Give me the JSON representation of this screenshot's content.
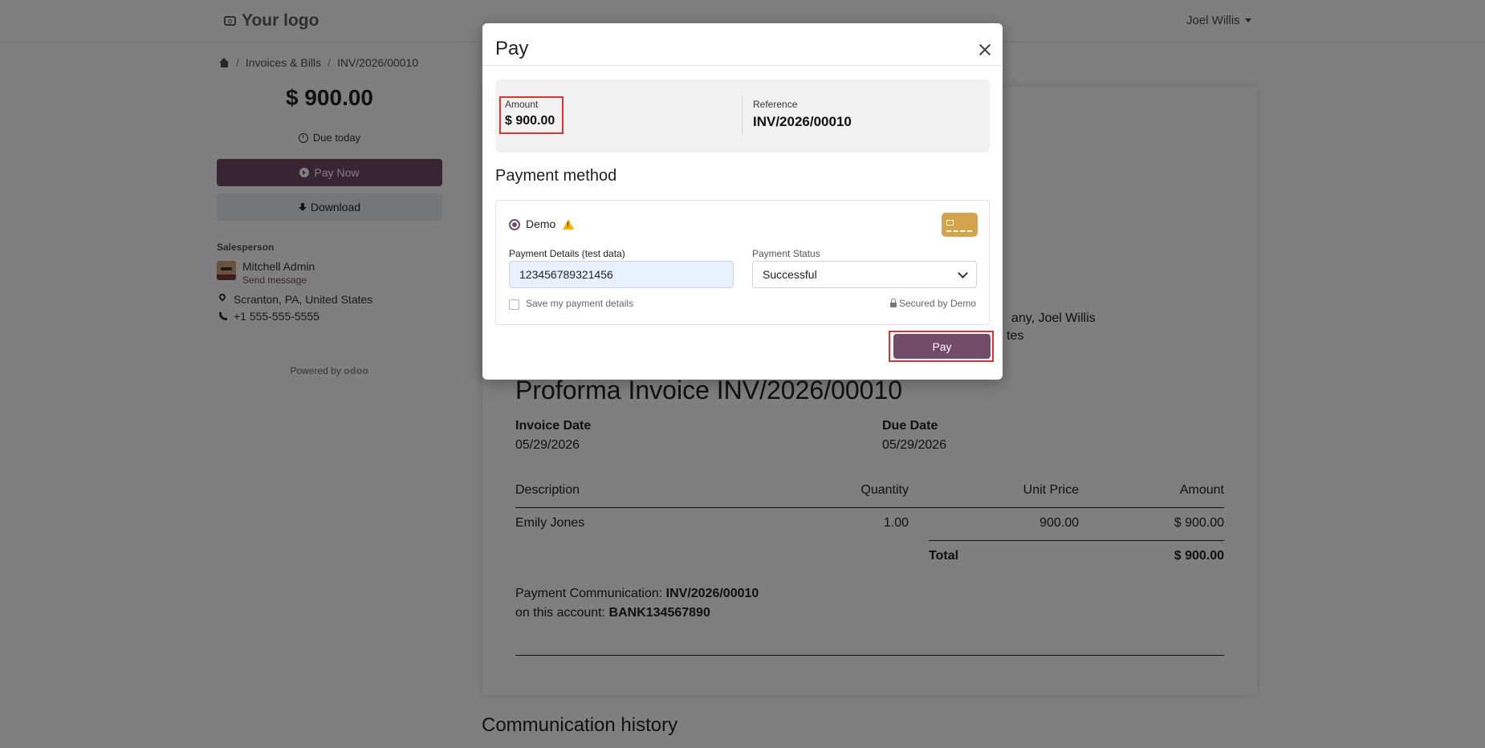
{
  "header": {
    "logo_text": "Your logo",
    "user_name": "Joel Willis"
  },
  "breadcrumb": {
    "section": "Invoices & Bills",
    "current": "INV/2026/00010"
  },
  "sidebar": {
    "amount": "$ 900.00",
    "due": "Due today",
    "pay_now": "Pay Now",
    "download": "Download",
    "salesperson_label": "Salesperson",
    "salesperson_name": "Mitchell Admin",
    "send_message": "Send message",
    "address": "Scranton, PA, United States",
    "phone": "+1 555-555-5555",
    "powered_by": "Powered by",
    "powered_brand": "odoo"
  },
  "document": {
    "partner_line1": "any, Joel Willis",
    "partner_line2": "tes",
    "title": "Proforma Invoice INV/2026/00010",
    "invoice_date_label": "Invoice Date",
    "invoice_date": "05/29/2026",
    "due_date_label": "Due Date",
    "due_date": "05/29/2026",
    "columns": [
      "Description",
      "Quantity",
      "Unit Price",
      "Amount"
    ],
    "rows": [
      {
        "description": "Emily Jones",
        "quantity": "1.00",
        "unit_price": "900.00",
        "amount": "$ 900.00"
      }
    ],
    "total_label": "Total",
    "total_value": "$ 900.00",
    "payment_comm_label": "Payment Communication:",
    "payment_comm_value": "INV/2026/00010",
    "account_label": "on this account:",
    "account_value": "BANK134567890",
    "communication_history": "Communication history"
  },
  "modal": {
    "title": "Pay",
    "amount_label": "Amount",
    "amount_value": "$ 900.00",
    "reference_label": "Reference",
    "reference_value": "INV/2026/00010",
    "payment_method_title": "Payment method",
    "method_name": "Demo",
    "payment_details_label": "Payment Details (test data)",
    "payment_details_value": "123456789321456",
    "payment_status_label": "Payment Status",
    "payment_status_value": "Successful",
    "save_details_label": "Save my payment details",
    "secured_by": "Secured by Demo",
    "pay_button": "Pay"
  },
  "colors": {
    "primary": "#714b67",
    "highlight": "#e03030",
    "warning": "#f0b400",
    "card": "#d4a44c"
  }
}
